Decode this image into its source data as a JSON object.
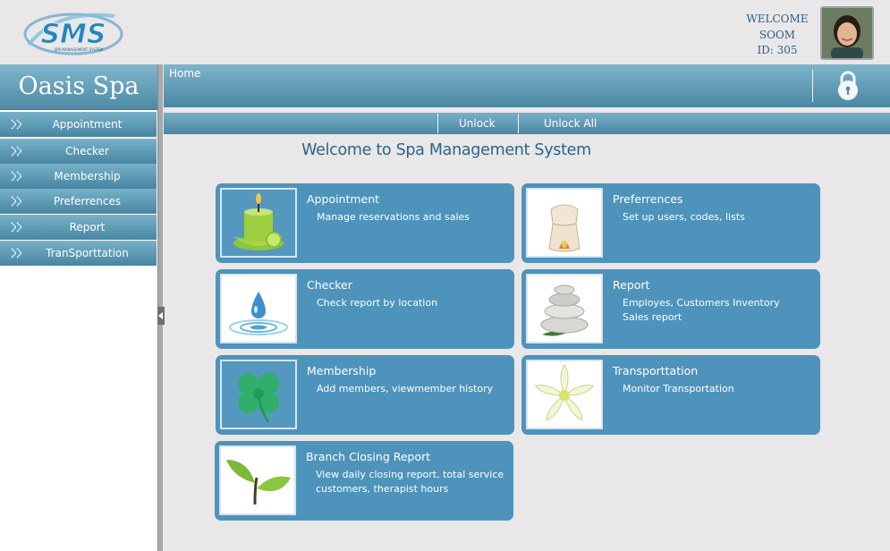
{
  "header": {
    "logo_text": "SMS",
    "logo_subtext": "SPA MANAGEMENT SYSTEM",
    "welcome": "WELCOME",
    "user": "SOOM",
    "user_id": "ID: 305"
  },
  "sidebar": {
    "brand": "Oasis Spa",
    "items": [
      {
        "label": "Appointment"
      },
      {
        "label": "Checker"
      },
      {
        "label": "Membership"
      },
      {
        "label": "Preferrences"
      },
      {
        "label": "Report"
      },
      {
        "label": "TranSporttation"
      }
    ]
  },
  "topbar": {
    "breadcrumb": "Home",
    "lock_icon": "padlock-icon"
  },
  "toolbar": {
    "unlock": "Unlock",
    "unlock_all": "Unlock All"
  },
  "main": {
    "title": "Welcome to Spa Management System",
    "cards": [
      {
        "title": "Appointment",
        "desc": "Manage reservations and sales",
        "icon": "candle-icon"
      },
      {
        "title": "Preferrences",
        "desc": "Set up users, codes, lists",
        "icon": "oil-burner-icon"
      },
      {
        "title": "Checker",
        "desc": "Check report by location",
        "icon": "water-drop-icon"
      },
      {
        "title": "Report",
        "desc": "Employes, Customers Inventory\nSales report",
        "icon": "stacked-stones-icon"
      },
      {
        "title": "Membership",
        "desc": "Add members, viewmember history",
        "icon": "clover-icon"
      },
      {
        "title": "Transporttation",
        "desc": "Monitor Transportation",
        "icon": "flower-icon"
      },
      {
        "title": "Branch Closing Report",
        "desc": "View daily closing report, total service\ncustomers, therapist hours",
        "icon": "leaves-icon"
      }
    ]
  },
  "colors": {
    "accent": "#4e93bb",
    "bar": "#5c9ab6",
    "title": "#2b6486"
  }
}
